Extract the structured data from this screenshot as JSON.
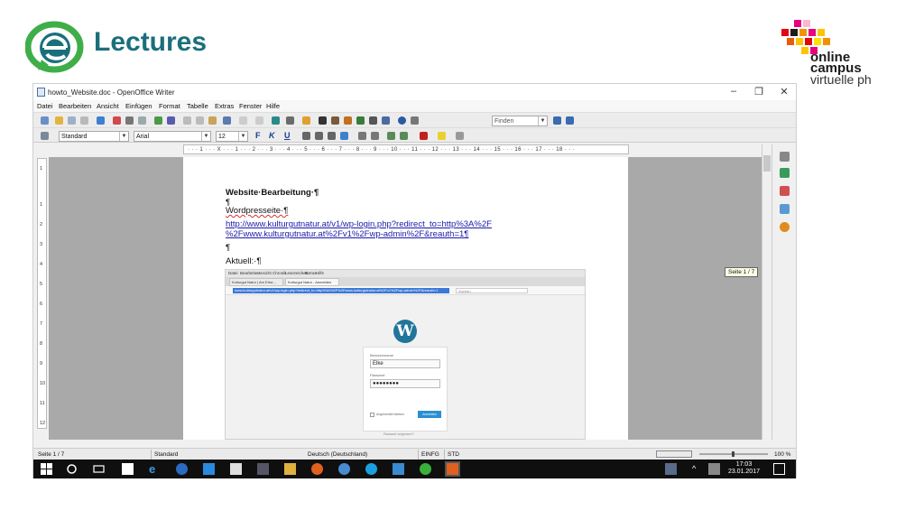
{
  "slide": {
    "brand_left": "Lectures",
    "brand_right": {
      "line1": "online",
      "line2": "campus",
      "line3": "virtuelle ph"
    }
  },
  "window": {
    "title": "howto_Website.doc - OpenOffice Writer",
    "controls": {
      "minimize": "–",
      "maximize": "❐",
      "close": "✕"
    },
    "menu": [
      "Datei",
      "Bearbeiten",
      "Ansicht",
      "Einfügen",
      "Format",
      "Tabelle",
      "Extras",
      "Fenster",
      "Hilfe"
    ],
    "find_placeholder": "Finden",
    "style_value": "Standard",
    "font_value": "Arial",
    "size_value": "12",
    "format_buttons": {
      "bold": "F",
      "italic": "K",
      "underline": "U"
    },
    "ruler_text": "· · · 1 · · · X · · · 1 · · · 2 · · · 3 · · · 4 · · · 5 · · · 6 · · · 7 · · · 8 · · · 9 · · · 10 · · · 11 · · · 12 · · · 13 · · · 14 · · · 15 · · · 16 · · · 17 · · · 18 · · ·",
    "ruler_v": [
      "1",
      "1",
      "2",
      "3",
      "4",
      "5",
      "6",
      "7",
      "8",
      "9",
      "10",
      "11",
      "12"
    ],
    "tooltip": "Seite 1 / 7"
  },
  "document": {
    "heading": "Website·Bearbeitung·¶",
    "pilcrow1": "¶",
    "line_wordpress": "Wordpresseite·¶",
    "link_line1": "http://www.kulturgutnatur.at/v1/wp-login.php?redirect_to=http%3A%2F",
    "link_line2": "%2Fwww.kulturgutnatur.at%2Fv1%2Fwp-admin%2F&reauth=1¶",
    "pilcrow2": "¶",
    "aktuell": "Aktuell:·¶"
  },
  "embedded": {
    "menu": [
      "Datei",
      "Bearbeiten",
      "Ansicht",
      "Chronik",
      "Lesezeichen",
      "Extras",
      "Hilfe"
    ],
    "tab1": "Kulturgut Natur | Am Erfor...",
    "tab2": "Kulturgut Natur - Anmelden",
    "url": "www.kulturgutnatur.at/v1/wp-login.php?redirect_to=http%3A%2F%2Fwww.kulturgutnatur.at%2Fv1%2Fwp-admin%2F&reauth=1",
    "search_placeholder": "Suchen",
    "wp_logo": "W",
    "user_label": "Benutzername",
    "user_value": "Elke",
    "pass_label": "Passwort",
    "pass_value": "●●●●●●●●",
    "remember": "Angemeldet bleiben",
    "login_btn": "Anmelden",
    "footer": "Passwort vergessen?"
  },
  "statusbar": {
    "page": "Seite 1 / 7",
    "style": "Standard",
    "language": "Deutsch (Deutschland)",
    "mode1": "EINFG",
    "mode2": "STD",
    "zoom": "100 %"
  },
  "taskbar": {
    "time": "17:03",
    "date": "23.01.2017"
  },
  "colors": {
    "brand_teal": "#1b6f7a",
    "brand_green": "#3fae49",
    "link_blue": "#1a1aaa",
    "wp_blue": "#21759b",
    "taskbar": "#0f0f0f"
  }
}
